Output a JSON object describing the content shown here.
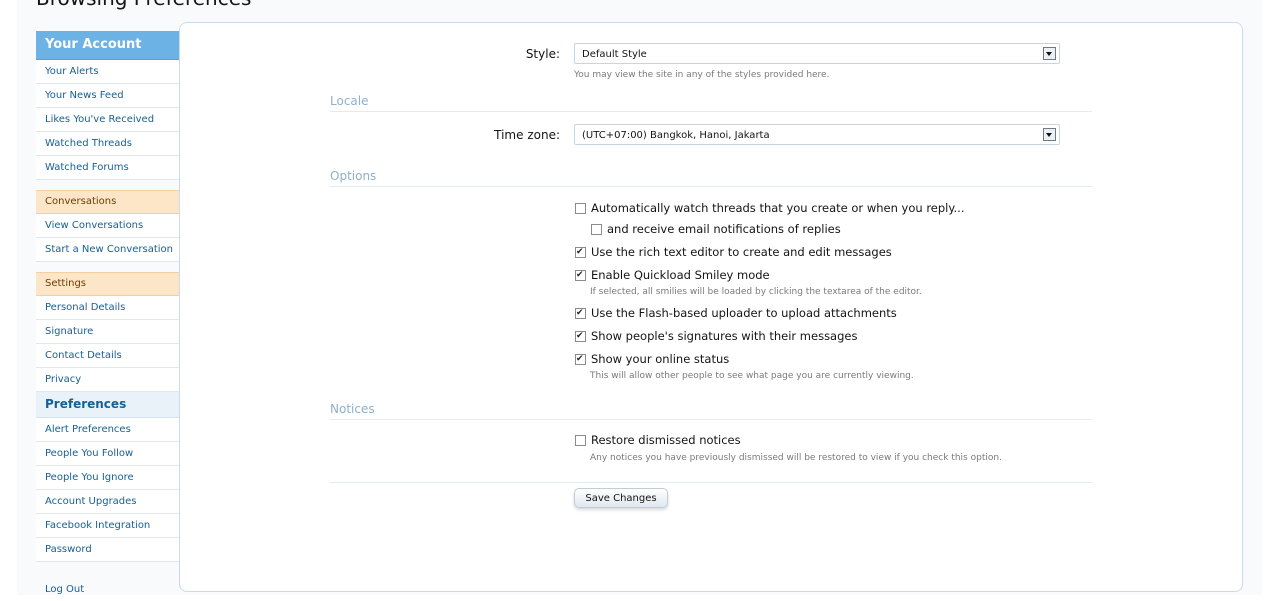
{
  "page": {
    "title": "Browsing Preferences"
  },
  "sidebar": {
    "account_header": "Your Account",
    "account_items": [
      "Your Alerts",
      "Your News Feed",
      "Likes You've Received",
      "Watched Threads",
      "Watched Forums"
    ],
    "conversations_header": "Conversations",
    "conversation_items": [
      "View Conversations",
      "Start a New Conversation"
    ],
    "settings_header": "Settings",
    "settings_items": [
      "Personal Details",
      "Signature",
      "Contact Details",
      "Privacy"
    ],
    "preferences_header": "Preferences",
    "preferences_items": [
      "Alert Preferences",
      "People You Follow",
      "People You Ignore",
      "Account Upgrades",
      "Facebook Integration",
      "Password"
    ],
    "logout": "Log Out"
  },
  "form": {
    "style": {
      "label": "Style:",
      "value": "Default Style",
      "hint": "You may view the site in any of the styles provided here."
    },
    "locale": {
      "heading": "Locale",
      "label": "Time zone:",
      "value": "(UTC+07:00) Bangkok, Hanoi, Jakarta"
    },
    "options": {
      "heading": "Options",
      "items": [
        {
          "label": "Automatically watch threads that you create or when you reply...",
          "checked": false
        },
        {
          "label": "and receive email notifications of replies",
          "checked": false
        },
        {
          "label": "Use the rich text editor to create and edit messages",
          "checked": true
        },
        {
          "label": "Enable Quickload Smiley mode",
          "checked": true,
          "hint": "If selected, all smilies will be loaded by clicking the textarea of the editor."
        },
        {
          "label": "Use the Flash-based uploader to upload attachments",
          "checked": true
        },
        {
          "label": "Show people's signatures with their messages",
          "checked": true
        },
        {
          "label": "Show your online status",
          "checked": true,
          "hint": "This will allow other people to see what page you are currently viewing."
        }
      ]
    },
    "notices": {
      "heading": "Notices",
      "item": {
        "label": "Restore dismissed notices",
        "checked": false,
        "hint": "Any notices you have previously dismissed will be restored to view if you check this option."
      }
    },
    "save_label": "Save Changes"
  }
}
